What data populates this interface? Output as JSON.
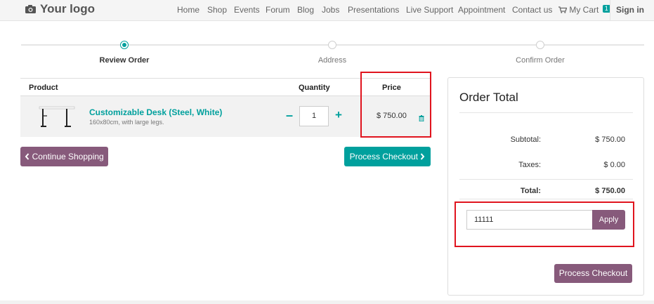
{
  "navbar": {
    "logo_text": "Your logo",
    "logo_icon": "camera-icon",
    "items": [
      {
        "label": "Home"
      },
      {
        "label": "Shop"
      },
      {
        "label": "Events"
      },
      {
        "label": "Forum"
      },
      {
        "label": "Blog"
      },
      {
        "label": "Jobs"
      },
      {
        "label": "Presentations"
      },
      {
        "label": "Live Support"
      },
      {
        "label": "Appointment"
      },
      {
        "label": "Contact us"
      }
    ],
    "cart_label": "My Cart",
    "cart_icon": "cart-icon",
    "cart_count": "1",
    "signin_label": "Sign in"
  },
  "wizard": {
    "steps": [
      {
        "label": "Review Order",
        "active": true
      },
      {
        "label": "Address",
        "active": false
      },
      {
        "label": "Confirm Order",
        "active": false
      }
    ]
  },
  "cart": {
    "headers": {
      "product": "Product",
      "quantity": "Quantity",
      "price": "Price"
    },
    "items": [
      {
        "name": "Customizable Desk (Steel, White)",
        "description": "160x80cm, with large legs.",
        "quantity": "1",
        "price": "$ 750.00"
      }
    ]
  },
  "buttons": {
    "continue_shopping": "Continue Shopping",
    "process_checkout": "Process Checkout"
  },
  "order_total": {
    "title": "Order Total",
    "subtotal_label": "Subtotal:",
    "subtotal_value": "$ 750.00",
    "taxes_label": "Taxes:",
    "taxes_value": "$ 0.00",
    "total_label": "Total:",
    "total_value": "$ 750.00",
    "coupon_value": "11111",
    "apply_label": "Apply",
    "checkout_label": "Process Checkout"
  },
  "colors": {
    "teal": "#00a09d",
    "purple": "#875a7b",
    "highlight_red": "#e0141e"
  }
}
